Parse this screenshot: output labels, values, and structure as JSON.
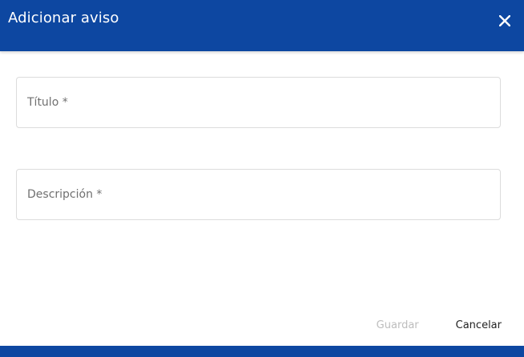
{
  "dialog": {
    "title": "Adicionar aviso",
    "close_icon": "close-icon"
  },
  "form": {
    "title_placeholder": "Título *",
    "title_value": "",
    "description_placeholder": "Descripción *",
    "description_value": ""
  },
  "actions": {
    "save_label": "Guardar",
    "save_enabled": false,
    "cancel_label": "Cancelar"
  },
  "colors": {
    "header_bg": "#0d47a1",
    "header_text": "#ffffff",
    "disabled_text": "#bdbdbd"
  }
}
